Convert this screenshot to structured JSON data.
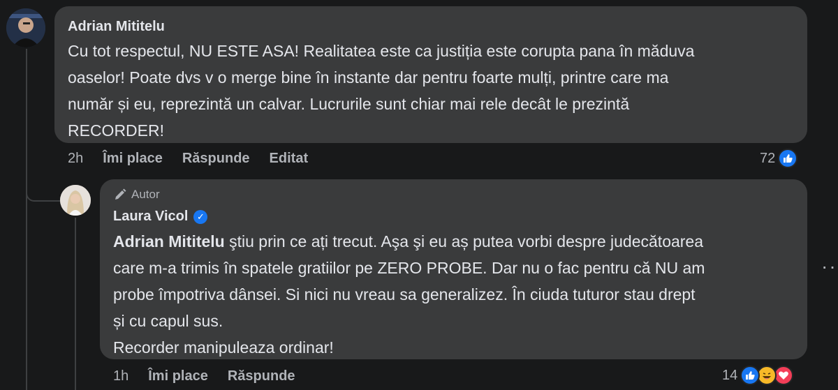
{
  "comment": {
    "author": "Adrian Mititelu",
    "text": "Cu tot respectul, NU ESTE ASA! Realitatea este ca justiția este corupta pana în măduva\noaselor! Poate dvs v o merge bine în instante dar pentru foarte mulți, printre care ma\nnumăr și eu, reprezintă un calvar. Lucrurile sunt chiar mai rele decât le prezintă\nRECORDER!",
    "time": "2h",
    "like_label": "Îmi place",
    "reply_label": "Răspunde",
    "edited_label": "Editat",
    "reaction_count": "72"
  },
  "reply": {
    "badge": "Autor",
    "author": "Laura Vicol",
    "mention": "Adrian Mititelu",
    "text": " ştiu prin ce ați trecut. Aşa şi eu aș putea vorbi despre judecătoarea\ncare m-a trimis în spatele gratiilor pe ZERO PROBE. Dar nu o fac pentru că NU am\nprobe împotriva dânsei. Si nici nu vreau sa generalizez. În ciuda tuturor stau drept\nși cu capul sus.\nRecorder manipuleaza ordinar!",
    "time": "1h",
    "like_label": "Îmi place",
    "reply_label": "Răspunde",
    "reaction_count": "14"
  },
  "colors": {
    "background": "#18191a",
    "bubble": "#3a3b3c",
    "like": "#1877f2",
    "love": "#f33e58",
    "haha": "#f7b928"
  },
  "icons": [
    "like-icon",
    "haha-icon",
    "love-icon",
    "verified-icon",
    "pencil-icon",
    "more-options-icon"
  ]
}
